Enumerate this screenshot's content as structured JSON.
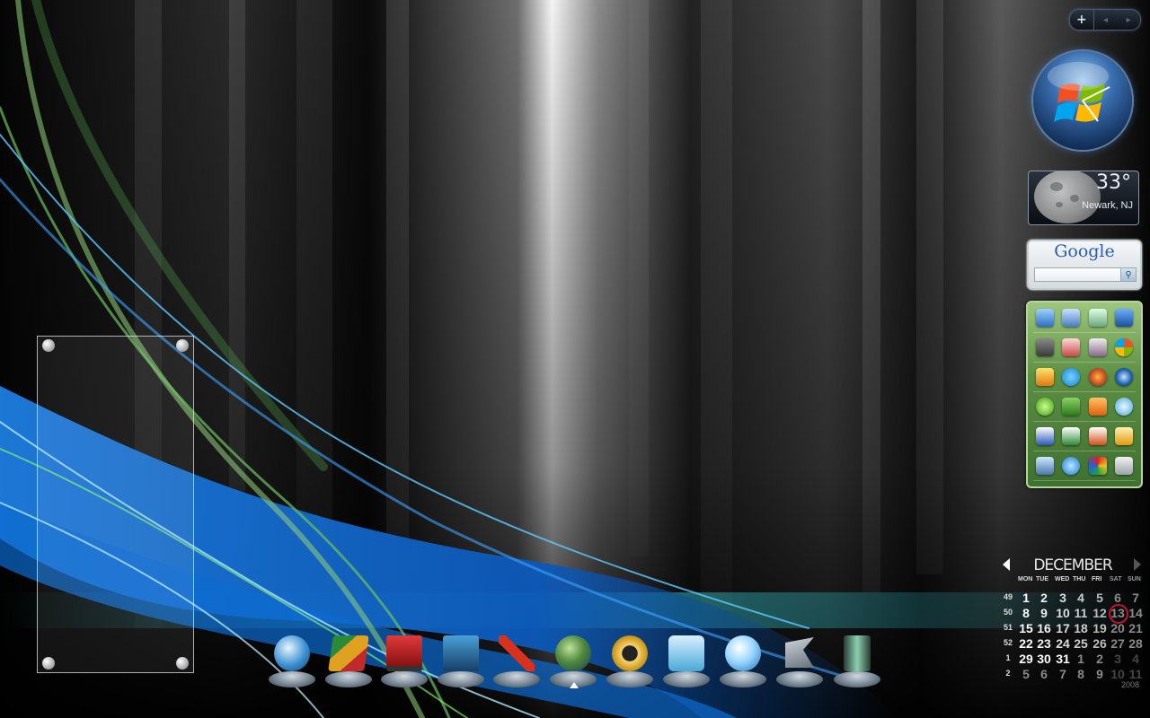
{
  "sidebar": {
    "controls": {
      "add": "+",
      "prev": "◂",
      "next": "▸"
    },
    "weather": {
      "temperature": "33°",
      "location": "Newark, NJ"
    },
    "google": {
      "logo": "Google",
      "search_placeholder": "",
      "search_button": "⚲"
    },
    "launcher": {
      "rows": [
        [
          "computer-icon",
          "network-icon",
          "recycle-bin-icon",
          "info-icon"
        ],
        [
          "pen-icon",
          "paint-icon",
          "camera-home-icon",
          "windows-icon"
        ],
        [
          "messenger-icon",
          "skype-icon",
          "firefox-icon",
          "globe-icon"
        ],
        [
          "media-center-icon",
          "utorrent-icon",
          "media-player-icon",
          "itunes-icon"
        ],
        [
          "word-icon",
          "excel-icon",
          "powerpoint-icon",
          "outlook-icon"
        ],
        [
          "display-icon",
          "ie-icon",
          "color-icon",
          "calculator-icon"
        ]
      ]
    }
  },
  "dock": {
    "items": [
      {
        "name": "finder-icon",
        "color": "#3b8fd1"
      },
      {
        "name": "paint-box-icon",
        "color": "#d48a1a"
      },
      {
        "name": "red-folder-icon",
        "color": "#b01a1a"
      },
      {
        "name": "downloads-folder-icon",
        "color": "#2e6f9e"
      },
      {
        "name": "pencil-ruler-icon",
        "color": "#c6321f"
      },
      {
        "name": "globe-icon",
        "color": "#4f8a3c"
      },
      {
        "name": "ring-icon",
        "color": "#e0b020"
      },
      {
        "name": "word-w-icon",
        "color": "#4aa8d8"
      },
      {
        "name": "itunes-icon",
        "color": "#3d9fd9"
      },
      {
        "name": "terminal-icon",
        "color": "#7a8a96"
      },
      {
        "name": "trash-icon",
        "color": "#5b8c7a"
      }
    ]
  },
  "calendar": {
    "month": "DECEMBER",
    "year": "2008",
    "weekday_headers": [
      "MON",
      "TUE",
      "WED",
      "THU",
      "FRI",
      "SAT",
      "SUN"
    ],
    "weeks": [
      {
        "week": "49",
        "days": [
          "1",
          "2",
          "3",
          "4",
          "5",
          "6",
          "7"
        ]
      },
      {
        "week": "50",
        "days": [
          "8",
          "9",
          "10",
          "11",
          "12",
          "13",
          "14"
        ]
      },
      {
        "week": "51",
        "days": [
          "15",
          "16",
          "17",
          "18",
          "19",
          "20",
          "21"
        ]
      },
      {
        "week": "52",
        "days": [
          "22",
          "23",
          "24",
          "25",
          "26",
          "27",
          "28"
        ]
      },
      {
        "week": "1",
        "days": [
          "29",
          "30",
          "31",
          "1",
          "2",
          "3",
          "4"
        ]
      },
      {
        "week": "2",
        "days": [
          "5",
          "6",
          "7",
          "8",
          "9",
          "10",
          "11"
        ]
      }
    ],
    "today": "13"
  },
  "colors": {
    "accent_green": "#7fbf4f",
    "accent_blue": "#2f8fe0",
    "today_ring": "#c8102e"
  }
}
